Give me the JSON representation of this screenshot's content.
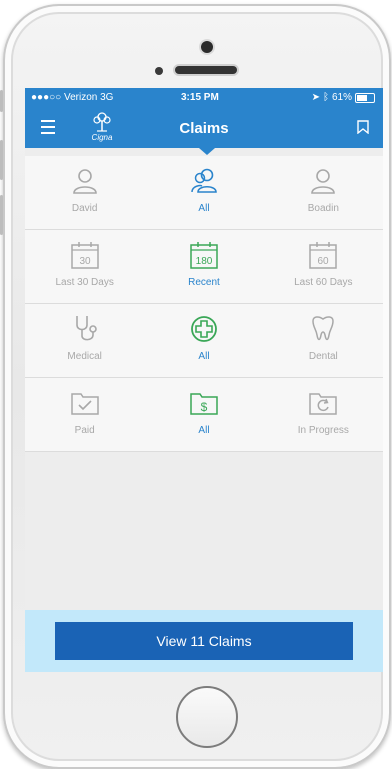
{
  "status_bar": {
    "carrier": "●●●○○ Verizon  3G",
    "time": "3:15 PM",
    "battery": "61%",
    "icons": [
      "location-arrow-icon",
      "bluetooth-icon",
      "battery-icon"
    ]
  },
  "nav_bar": {
    "title": "Claims",
    "logo_text": "Cigna",
    "icons": [
      "menu-icon",
      "cigna-tree-logo",
      "bookmark-icon"
    ]
  },
  "filters": {
    "people": [
      {
        "label": "David",
        "icon": "person-icon",
        "selected": false
      },
      {
        "label": "All",
        "icon": "group-icon",
        "selected": true
      },
      {
        "label": "Boadin",
        "icon": "person-icon",
        "selected": false
      }
    ],
    "time": [
      {
        "label": "Last 30 Days",
        "value": "30",
        "icon": "calendar-icon",
        "selected": false
      },
      {
        "label": "Recent",
        "value": "180",
        "icon": "calendar-icon",
        "selected": true
      },
      {
        "label": "Last 60 Days",
        "value": "60",
        "icon": "calendar-icon",
        "selected": false
      }
    ],
    "type": [
      {
        "label": "Medical",
        "icon": "stethoscope-icon",
        "selected": false
      },
      {
        "label": "All",
        "icon": "medical-cross-icon",
        "selected": true
      },
      {
        "label": "Dental",
        "icon": "tooth-icon",
        "selected": false
      }
    ],
    "status": [
      {
        "label": "Paid",
        "icon": "folder-check-icon",
        "selected": false
      },
      {
        "label": "All",
        "icon": "folder-dollar-icon",
        "selected": true
      },
      {
        "label": "In Progress",
        "icon": "folder-refresh-icon",
        "selected": false
      }
    ]
  },
  "action": {
    "label": "View 11 Claims"
  },
  "colors": {
    "primary": "#2a84cc",
    "green": "#3aa757",
    "gray": "#a8a8a8",
    "button": "#1a63b5"
  }
}
